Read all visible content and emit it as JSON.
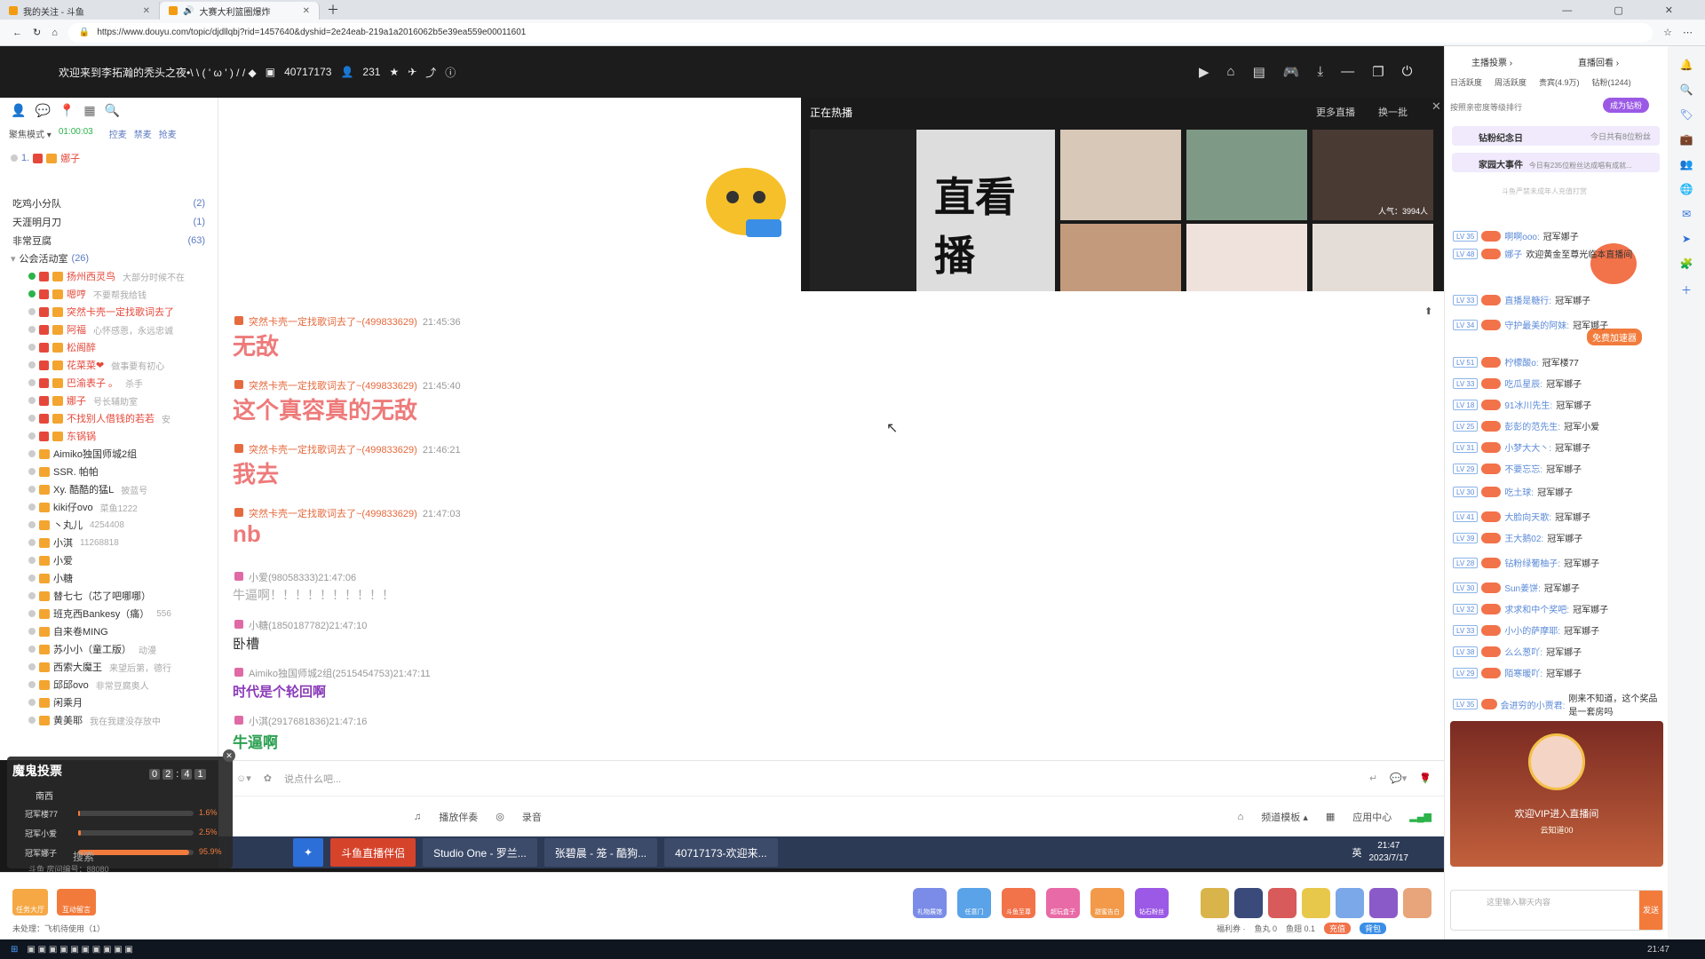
{
  "browser": {
    "tabs": [
      {
        "label": "我的关注 - 斗鱼"
      },
      {
        "label": "大赛大利篮圈爆炸"
      }
    ],
    "url": "https://www.douyu.com/topic/djdllqbj?rid=1457640&dyshid=2e24eab-219a1a2016062b5e39ea559e00011601"
  },
  "header": {
    "title": "欢迎来到李拓瀚的秃头之夜•\\ \\ ( ' ω ' ) / / ◆",
    "room_id": "40717173",
    "viewers": "231"
  },
  "sidebar": {
    "mode_label": "聚焦模式 ▾",
    "timer": "01:00:03",
    "actions": [
      "控麦",
      "禁麦",
      "抢麦"
    ],
    "top_user": "娜子",
    "groups": [
      {
        "name": "吃鸡小分队",
        "count": "(2)"
      },
      {
        "name": "天涯明月刀",
        "count": "(1)"
      },
      {
        "name": "非常豆腐",
        "count": "(63)"
      }
    ],
    "public_lobby": "公会活动室",
    "public_count": "(26)",
    "members": [
      {
        "name": "扬州西灵鸟",
        "note": "大部分时候不在"
      },
      {
        "name": "嗯哼",
        "note": "不要帮我给钱"
      },
      {
        "name": "突然卡壳一定找歌词去了",
        "note": ""
      },
      {
        "name": "阿福",
        "note": "心怀感恩，永远忠诚"
      },
      {
        "name": "松阁醉",
        "note": ""
      },
      {
        "name": "花菜菜❤",
        "note": "做事要有初心"
      },
      {
        "name": "巴渝表子 。",
        "note": "杀手"
      },
      {
        "name": "娜子",
        "note": "号长辅助室"
      },
      {
        "name": "不找别人借钱的若若",
        "note": "安"
      },
      {
        "name": "东锅锅",
        "note": ""
      },
      {
        "name": "Aimiko独国师城2组",
        "note": ""
      },
      {
        "name": "SSR. 帕帕",
        "note": ""
      },
      {
        "name": "Xy. 酷酷的猛L",
        "note": "披蓝号"
      },
      {
        "name": "kiki仔ovo",
        "note": "菜鱼1222"
      },
      {
        "name": "丶丸儿",
        "note": "4254408"
      },
      {
        "name": "小淇",
        "note": "11268818"
      },
      {
        "name": "小爱",
        "note": ""
      },
      {
        "name": "小糖",
        "note": ""
      },
      {
        "name": "替七七（芯了吧哪哪）",
        "note": ""
      },
      {
        "name": "班克西Bankesy（痛）",
        "note": "556"
      },
      {
        "name": "自来卷MING",
        "note": ""
      },
      {
        "name": "苏小小（童工版）",
        "note": "动漫"
      },
      {
        "name": "西索大魔王",
        "note": "来望后第，德行"
      },
      {
        "name": "邱邱ovo",
        "note": "非常豆腐奥人"
      },
      {
        "name": "闲乘月",
        "note": ""
      },
      {
        "name": "黄美耶",
        "note": "我在我建没存放中"
      }
    ]
  },
  "hot_panel": {
    "title": "正在热播",
    "more": "更多直播",
    "refresh": "换一批",
    "featured_text": "直看播",
    "viewer_tag": "人气：3994人"
  },
  "chat": {
    "messages": [
      {
        "user": "突然卡壳一定找歌词去了~(499833629)",
        "time": "21:45:36",
        "text": "无敌",
        "style": "big"
      },
      {
        "user": "突然卡壳一定找歌词去了~(499833629)",
        "time": "21:45:40",
        "text": "这个真容真的无敌",
        "style": "big"
      },
      {
        "user": "突然卡壳一定找歌词去了~(499833629)",
        "time": "21:46:21",
        "text": "我去",
        "style": "big"
      },
      {
        "user": "突然卡壳一定找歌词去了~(499833629)",
        "time": "21:47:03",
        "text": "nb",
        "style": "big"
      },
      {
        "user": "小爱(98058333)",
        "time": "21:47:06",
        "text": "牛逼啊！！！！！！！！！！",
        "style": "grey"
      },
      {
        "user": "小糖(1850187782)",
        "time": "21:47:10",
        "text": "卧槽",
        "style": "dark"
      },
      {
        "user": "Aimiko独国师城2组(2515454753)",
        "time": "21:47:11",
        "text": "时代是个轮回啊",
        "style": "purple"
      },
      {
        "user": "小淇(2917681836)",
        "time": "21:47:16",
        "text": "牛逼啊",
        "style": "green"
      }
    ],
    "input_placeholder": "说点什么吧..."
  },
  "controls": {
    "items": [
      "播放伴奏",
      "录音"
    ],
    "right_items": [
      "频道模板 ▴",
      "应用中心"
    ]
  },
  "inner_taskbar": {
    "apps": [
      "斗鱼直播伴侣",
      "Studio One - 罗兰...",
      "张碧晨 - 笼 - 酷狗...",
      "40717173-欢迎来..."
    ],
    "time": "21:47",
    "date": "2023/7/17",
    "lang": "英"
  },
  "rank_widget": {
    "title": "魔鬼投票",
    "countdown": [
      "0",
      "2",
      ":",
      "4",
      "1"
    ],
    "location": "南西",
    "rows": [
      {
        "name": "冠军楼77",
        "pct": "1.6%",
        "fill": 0.016
      },
      {
        "name": "冠军小爱",
        "pct": "2.5%",
        "fill": 0.025
      },
      {
        "name": "冠军娜子",
        "pct": "95.9%",
        "fill": 0.959
      }
    ],
    "search": "搜索",
    "room_label": "斗鱼 房间编号：88080"
  },
  "gift_bar": {
    "left_buttons": [
      "任务大厅",
      "互动留言"
    ],
    "notice": "未处理：飞机待使用（1）",
    "gift_labels": [
      "礼物展馆",
      "任意门",
      "斗鱼至尊",
      "超玩盒子",
      "甜蜜告白",
      "钻石粉丝"
    ],
    "footer": [
      "福利券 ·",
      "鱼丸 0",
      "鱼翅 0.1",
      "充值",
      "背包"
    ]
  },
  "right_panel": {
    "tabs_top": [
      "主播投票 ›",
      "直播回看 ›"
    ],
    "rank_tabs": [
      "日活跃度",
      "周活跃度",
      "贵宾(4.9万)",
      "钻粉(1244)"
    ],
    "rank_note": "按照亲密度等级排行",
    "join_fans": "成为钻粉",
    "diamond_day": "钻粉纪念日",
    "diamond_day_note": "今日共有8位粉丝",
    "big_event": "家园大事件",
    "big_event_note": "今日有235位粉丝达成唱有成就...",
    "privacy_note": "斗鱼严禁未成年人充值打赏",
    "chats": [
      {
        "lv": "LV 35",
        "user": "啊啊ooo:",
        "text": "冠军娜子"
      },
      {
        "lv": "LV 48",
        "user": "娜子",
        "text": "欢迎黄金至尊光临本直播间"
      },
      {
        "lv": "LV 33",
        "user": "直播是糖行:",
        "text": "冠军娜子"
      },
      {
        "lv": "LV 34",
        "user": "守护最美的阿妹:",
        "text": "冠军娜子"
      },
      {
        "lv": "LV 51",
        "user": "柠檬酸o:",
        "text": "冠军楼77"
      },
      {
        "lv": "LV 33",
        "user": "吃瓜星辰:",
        "text": "冠军娜子"
      },
      {
        "lv": "LV 18",
        "user": "91冰川先生:",
        "text": "冠军娜子"
      },
      {
        "lv": "LV 25",
        "user": "彭彭的范先生:",
        "text": "冠军小爱"
      },
      {
        "lv": "LV 31",
        "user": "小梦大大丶:",
        "text": "冠军娜子"
      },
      {
        "lv": "LV 29",
        "user": "不要忘忘:",
        "text": "冠军娜子"
      },
      {
        "lv": "LV 30",
        "user": "吃土球:",
        "text": "冠军娜子"
      },
      {
        "lv": "LV 41",
        "user": "大脸向天歌:",
        "text": "冠军娜子"
      },
      {
        "lv": "LV 39",
        "user": "王大鹅02:",
        "text": "冠军娜子"
      },
      {
        "lv": "LV 28",
        "user": "钻粉绿葡柚子:",
        "text": "冠军娜子"
      },
      {
        "lv": "LV 30",
        "user": "Sun姜饼:",
        "text": "冠军娜子"
      },
      {
        "lv": "LV 32",
        "user": "求求和中个奖吧:",
        "text": "冠军娜子"
      },
      {
        "lv": "LV 33",
        "user": "小小的萨摩耶:",
        "text": "冠军娜子"
      },
      {
        "lv": "LV 38",
        "user": "么么葱吖:",
        "text": "冠军娜子"
      },
      {
        "lv": "LV 29",
        "user": "陌寒暖吖:",
        "text": "冠军娜子"
      },
      {
        "lv": "LV 35",
        "user": "会进穷的小贾君:",
        "text": "刚来不知道，这个奖品是一套房吗"
      }
    ],
    "free_accel": "免费加速器",
    "vip_welcome": "欢迎VIP进入直播间",
    "vip_user": "云知道00",
    "input_placeholder": "这里输入聊天内容",
    "send": "发送"
  },
  "os_taskbar": {
    "time": "21:47"
  }
}
